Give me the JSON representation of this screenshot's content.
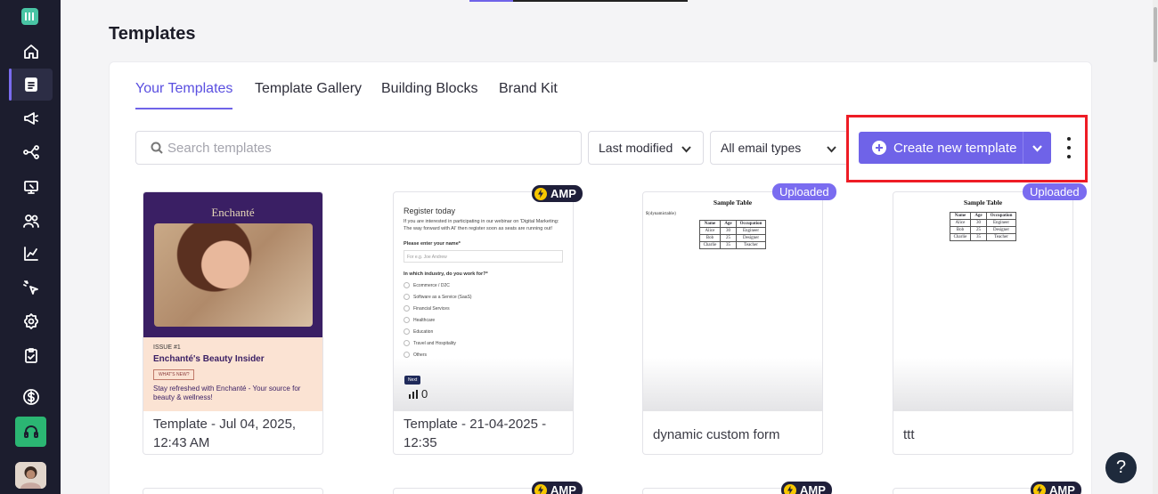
{
  "page": {
    "title": "Templates"
  },
  "tabs": [
    {
      "label": "Your Templates",
      "active": true
    },
    {
      "label": "Template Gallery",
      "active": false
    },
    {
      "label": "Building Blocks",
      "active": false
    },
    {
      "label": "Brand Kit",
      "active": false
    }
  ],
  "toolbar": {
    "search_placeholder": "Search templates",
    "sort_value": "Last modified",
    "type_value": "All email types",
    "create_label": "Create new template"
  },
  "templates": [
    {
      "name": "Template - Jul 04, 2025, 12:43 AM",
      "badge": "",
      "thumb": {
        "logo": "Enchanté",
        "issue": "ISSUE #1",
        "title": "Enchanté's Beauty Insider",
        "button": "WHAT'S NEW?",
        "desc": "Stay refreshed with Enchanté - Your source for beauty & wellness!"
      }
    },
    {
      "name": "Template - 21-04-2025 - 12:35",
      "badge": "AMP",
      "thumb": {
        "title": "Register today",
        "intro": "If you are interested in participating in our webinar on 'Digital Marketing: The way forward with AI' then register soon as seats are running out!",
        "name_label": "Please enter your name*",
        "name_placeholder": "For e.g. Joe Andrew",
        "industry_label": "In which industry, do you work for?*",
        "options": [
          "Ecommerce / D2C",
          "Software as a Service (SaaS)",
          "Financial Services",
          "Healthcare",
          "Education",
          "Travel and Hospitality",
          "Others"
        ],
        "next": "Next",
        "stat": "0"
      }
    },
    {
      "name": "dynamic custom form",
      "badge": "Uploaded",
      "thumb": {
        "title": "Sample Table",
        "variable": "${dynamictable}",
        "headers": [
          "Name",
          "Age",
          "Occupation"
        ],
        "rows": [
          [
            "Alice",
            "30",
            "Engineer"
          ],
          [
            "Bob",
            "25",
            "Designer"
          ],
          [
            "Charlie",
            "35",
            "Teacher"
          ]
        ]
      }
    },
    {
      "name": "ttt",
      "badge": "Uploaded",
      "thumb": {
        "title": "Sample Table",
        "headers": [
          "Name",
          "Age",
          "Occupation"
        ],
        "rows": [
          [
            "Alice",
            "30",
            "Engineer"
          ],
          [
            "Bob",
            "25",
            "Designer"
          ],
          [
            "Charlie",
            "35",
            "Teacher"
          ]
        ]
      }
    }
  ],
  "bottom_row_badges": [
    "AMP",
    "AMP",
    "AMP"
  ],
  "help": {
    "label": "?"
  },
  "colors": {
    "accent": "#6f63e8",
    "sidebar": "#1c1d2e",
    "highlight": "#ee1c25",
    "support": "#2bb673"
  }
}
